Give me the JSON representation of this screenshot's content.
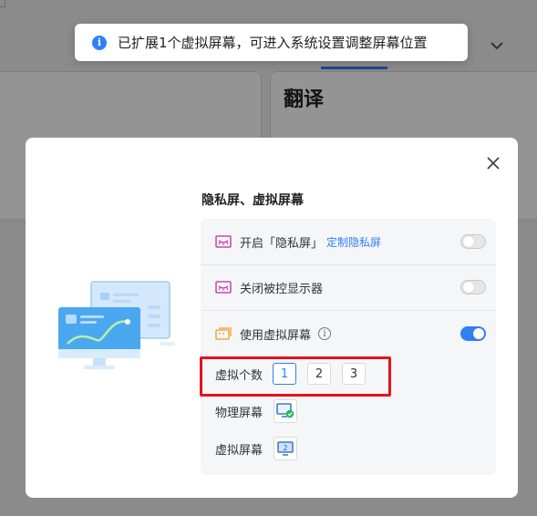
{
  "toast": {
    "icon": "info-icon",
    "message": "已扩展1个虚拟屏幕，可进入系统设置调整屏幕位置"
  },
  "background": {
    "right_card_title": "翻译",
    "chevron": "chevron-down-icon"
  },
  "dialog": {
    "close_icon": "close-icon",
    "illustration": "dual-monitor-illustration",
    "section_title": "隐私屏、虚拟屏幕",
    "rows": [
      {
        "icon": "privacy-screen-icon",
        "label": "开启「隐私屏」",
        "link": "定制隐私屏",
        "toggle": "off"
      },
      {
        "icon": "privacy-screen-icon",
        "label": "关闭被控显示器",
        "toggle": "off"
      },
      {
        "icon": "virtual-screen-icon",
        "label": "使用虚拟屏幕",
        "info_icon": "info-icon",
        "toggle": "on"
      }
    ],
    "virtual_count": {
      "label": "虚拟个数",
      "options": [
        "1",
        "2",
        "3"
      ],
      "selected": "1"
    },
    "physical_screen": {
      "label": "物理屏幕",
      "icon": "physical-monitor-check-icon"
    },
    "virtual_screen": {
      "label": "虚拟屏幕",
      "icon": "virtual-monitor-2-icon",
      "badge": "2"
    }
  },
  "colors": {
    "accent": "#2f7ff5",
    "highlight": "#e3131b",
    "icon_pink": "#c22aa0",
    "icon_orange": "#f29a1e",
    "check_green": "#1fba5a"
  }
}
